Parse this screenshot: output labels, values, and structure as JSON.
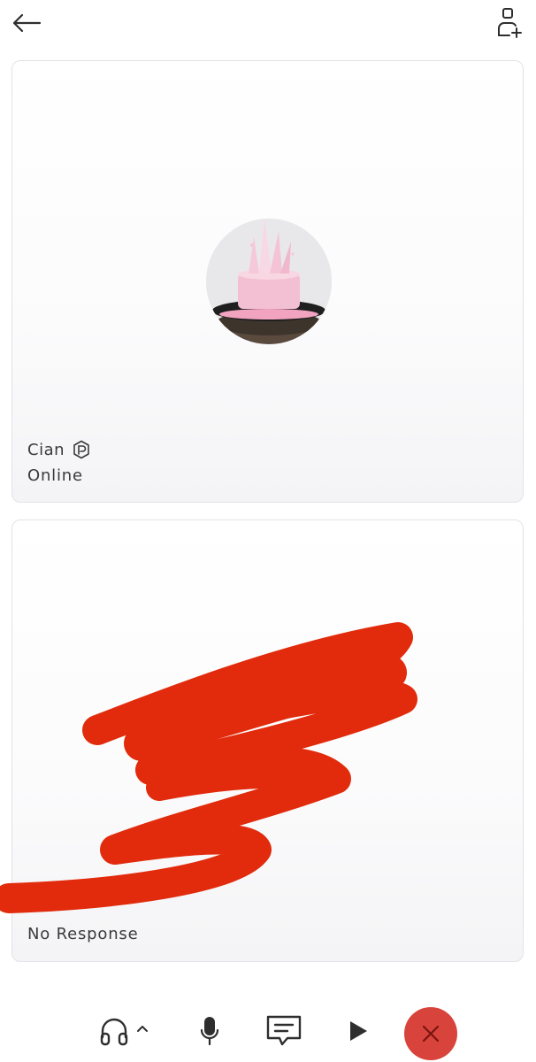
{
  "header": {
    "back_icon": "arrow-left-icon",
    "add_icon": "add-person-icon"
  },
  "participants": [
    {
      "name": "Cian",
      "badge_icon": "premium-badge-icon",
      "status": "Online",
      "avatar": "pink-crown-avatar"
    },
    {
      "status": "No Response"
    }
  ],
  "controls": {
    "audio_icon": "headphones-icon",
    "audio_chevron_icon": "chevron-up-icon",
    "mic_icon": "microphone-icon",
    "chat_icon": "chat-bubble-icon",
    "play_icon": "play-icon",
    "end_icon": "close-icon",
    "end_color": "#d8433b"
  },
  "colors": {
    "card_border": "#e3e3e8",
    "text": "#3a3a3a",
    "scribble": "#e12b0c"
  }
}
